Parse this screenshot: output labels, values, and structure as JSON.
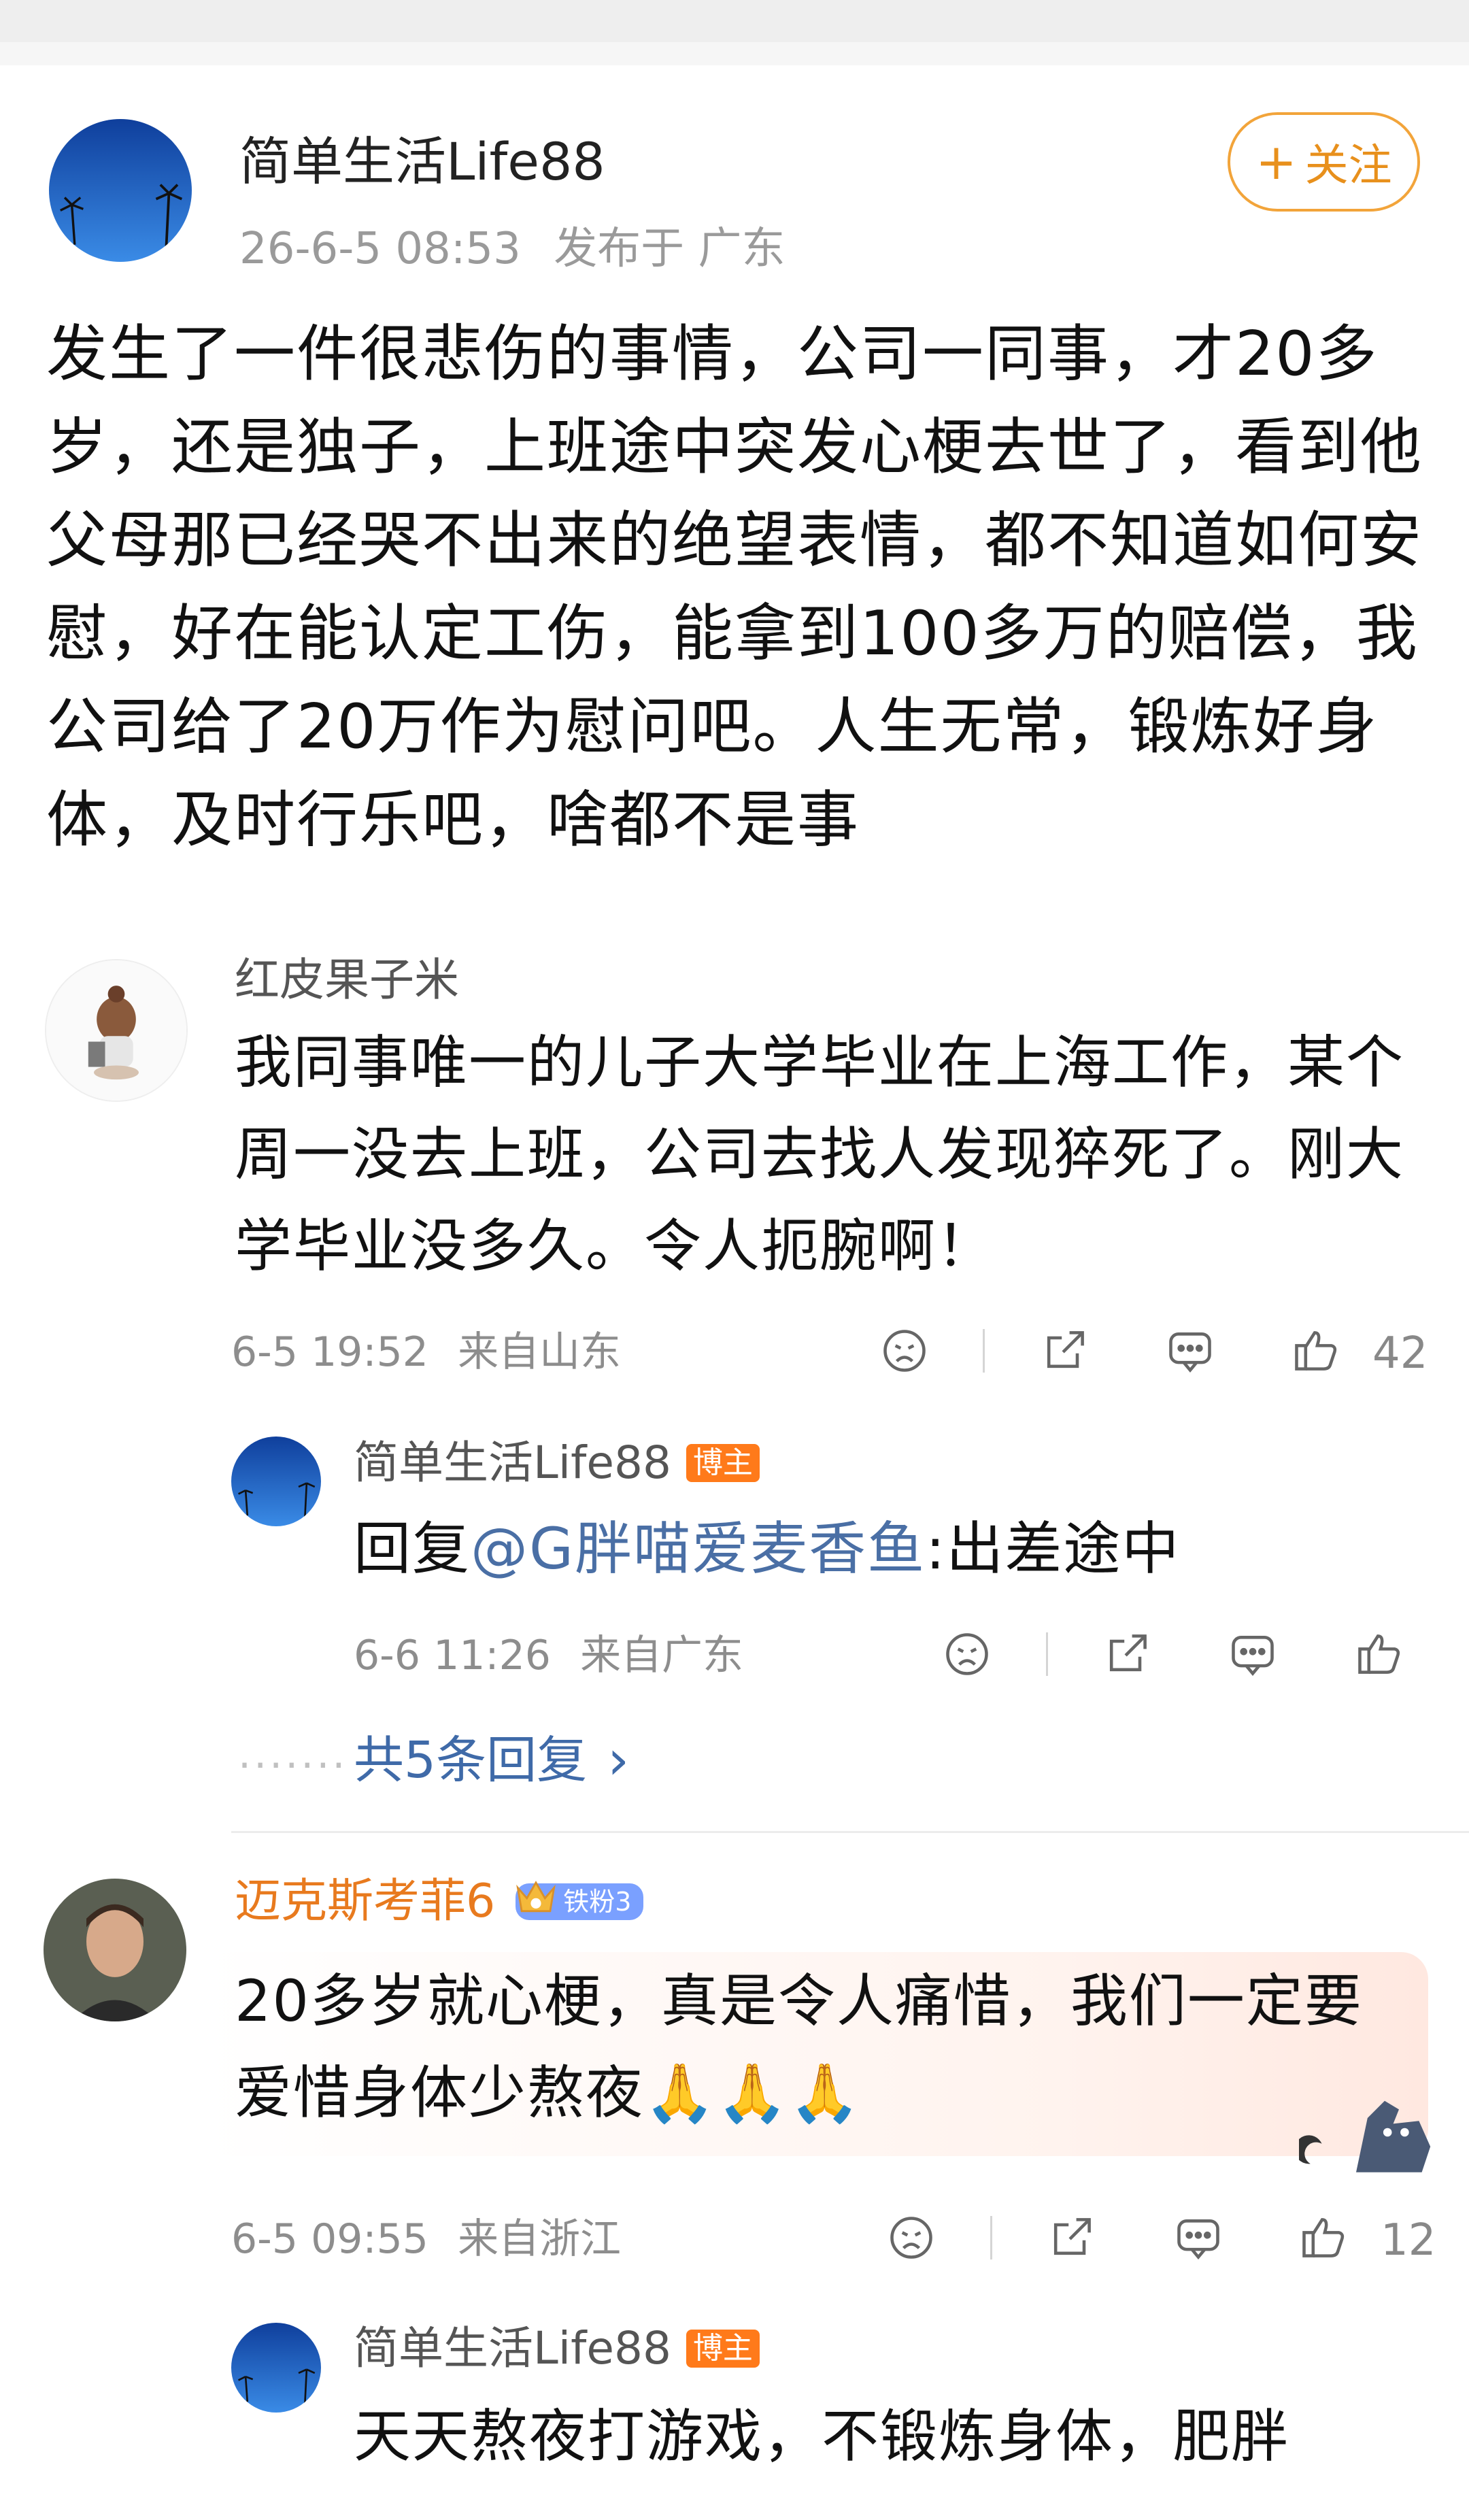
{
  "post": {
    "author": "简单生活Life88",
    "time": "26-6-5 08:53",
    "location": "发布于 广东",
    "follow_label": "关注",
    "follow_plus": "+",
    "text": "发生了一件很悲伤的事情，公司一同事，才20多岁，还是独子，上班途中突发心梗去世了，看到他父母那已经哭不出来的绝望表情，都不知道如何安慰，好在能认定工伤，能拿到100多万的赔偿，我公司给了20万作为慰问吧。人生无常，锻炼好身体，及时行乐吧，啥都不是事"
  },
  "comments": [
    {
      "name": "红皮果子米",
      "text": "我同事唯一的儿子大学毕业在上海工作，某个周一没去上班，公司去找人发现猝死了。刚大学毕业没多久。令人扼腕啊！",
      "time": "6-5 19:52",
      "location": "来自山东",
      "likes": "42",
      "reply": {
        "name": "简单生活Life88",
        "badge": "博主",
        "prefix": "回复",
        "mention": "@G胖喵爱麦香鱼",
        "text": ":出差途中",
        "time": "6-6 11:26",
        "location": "来自广东"
      },
      "more_replies": "共5条回复",
      "more_arrow": "›",
      "more_dots": "·······"
    },
    {
      "name": "迈克斯考菲6",
      "fan_badge": "铁粉3",
      "text": "20多岁就心梗，真是令人痛惜，我们一定要爱惜身体少熬夜🙏🙏🙏",
      "time": "6-5 09:55",
      "location": "来自浙江",
      "likes": "12",
      "reply": {
        "name": "简单生活Life88",
        "badge": "博主",
        "text": "天天熬夜打游戏，不锻炼身体，肥胖"
      }
    }
  ],
  "icons": {
    "dislike": "sad-face-icon",
    "share": "share-icon",
    "comment": "comment-icon",
    "like": "thumbs-up-icon"
  },
  "colors": {
    "follow": "#f2a43a",
    "mention": "#4a6fa5",
    "badge": "#ff7a1a",
    "fan_name": "#e87a1e"
  }
}
